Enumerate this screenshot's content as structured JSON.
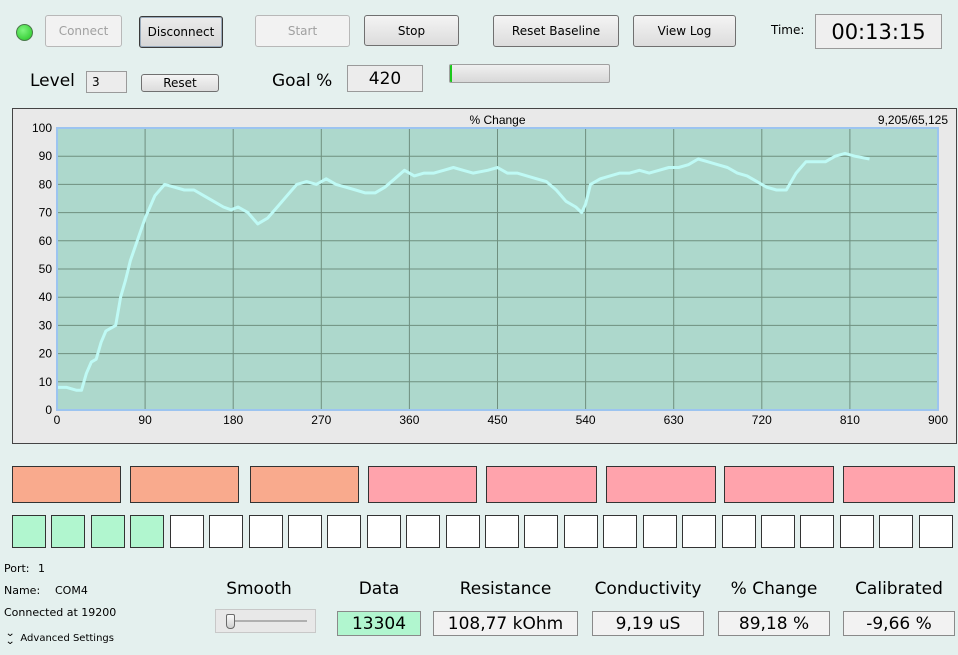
{
  "toolbar": {
    "connect_label": "Connect",
    "disconnect_label": "Disconnect",
    "start_label": "Start",
    "stop_label": "Stop",
    "reset_baseline_label": "Reset Baseline",
    "view_log_label": "View Log",
    "time_label": "Time:",
    "time_value": "00:13:15"
  },
  "controls": {
    "level_label": "Level",
    "level_value": "3",
    "reset_label": "Reset",
    "goal_label": "Goal %",
    "goal_value": "420",
    "goal_progress": 0.01
  },
  "colors": {
    "status_led": "#22c422",
    "plot_background": "#add8cc",
    "series_line": "#bffaf5",
    "stage_orange": "#f9aa8d",
    "stage_pink": "#ffa3ac",
    "step_done": "#b1f6cf"
  },
  "chart_data": {
    "type": "line",
    "title": "% Change",
    "counter": "9,205/65,125",
    "xlim": [
      0,
      900
    ],
    "ylim": [
      0,
      100
    ],
    "x_ticks": [
      0,
      90,
      180,
      270,
      360,
      450,
      540,
      630,
      720,
      810,
      900
    ],
    "y_ticks": [
      0,
      10,
      20,
      30,
      40,
      50,
      60,
      70,
      80,
      90,
      100
    ],
    "grid": true,
    "series": [
      {
        "points": [
          [
            0,
            8
          ],
          [
            10,
            8
          ],
          [
            20,
            7
          ],
          [
            25,
            7
          ],
          [
            30,
            13
          ],
          [
            35,
            17
          ],
          [
            40,
            18
          ],
          [
            45,
            24
          ],
          [
            50,
            28
          ],
          [
            55,
            29
          ],
          [
            60,
            30
          ],
          [
            65,
            40
          ],
          [
            70,
            46
          ],
          [
            75,
            53
          ],
          [
            80,
            58
          ],
          [
            85,
            63
          ],
          [
            90,
            68
          ],
          [
            95,
            72
          ],
          [
            100,
            76
          ],
          [
            105,
            78
          ],
          [
            110,
            80
          ],
          [
            120,
            79
          ],
          [
            130,
            78
          ],
          [
            140,
            78
          ],
          [
            150,
            76
          ],
          [
            160,
            74
          ],
          [
            170,
            72
          ],
          [
            178,
            71
          ],
          [
            185,
            72
          ],
          [
            195,
            70
          ],
          [
            205,
            66
          ],
          [
            215,
            68
          ],
          [
            225,
            72
          ],
          [
            235,
            76
          ],
          [
            245,
            80
          ],
          [
            255,
            81
          ],
          [
            265,
            80
          ],
          [
            275,
            82
          ],
          [
            285,
            80
          ],
          [
            295,
            79
          ],
          [
            305,
            78
          ],
          [
            315,
            77
          ],
          [
            325,
            77
          ],
          [
            335,
            79
          ],
          [
            345,
            82
          ],
          [
            355,
            85
          ],
          [
            365,
            83
          ],
          [
            375,
            84
          ],
          [
            385,
            84
          ],
          [
            395,
            85
          ],
          [
            405,
            86
          ],
          [
            415,
            85
          ],
          [
            425,
            84
          ],
          [
            440,
            85
          ],
          [
            450,
            86
          ],
          [
            460,
            84
          ],
          [
            470,
            84
          ],
          [
            480,
            83
          ],
          [
            490,
            82
          ],
          [
            500,
            81
          ],
          [
            510,
            78
          ],
          [
            520,
            74
          ],
          [
            530,
            72
          ],
          [
            536,
            70
          ],
          [
            540,
            73
          ],
          [
            545,
            80
          ],
          [
            555,
            82
          ],
          [
            565,
            83
          ],
          [
            575,
            84
          ],
          [
            585,
            84
          ],
          [
            595,
            85
          ],
          [
            605,
            84
          ],
          [
            615,
            85
          ],
          [
            625,
            86
          ],
          [
            635,
            86
          ],
          [
            645,
            87
          ],
          [
            655,
            89
          ],
          [
            665,
            88
          ],
          [
            675,
            87
          ],
          [
            685,
            86
          ],
          [
            695,
            84
          ],
          [
            705,
            83
          ],
          [
            715,
            81
          ],
          [
            725,
            79
          ],
          [
            735,
            78
          ],
          [
            745,
            78
          ],
          [
            755,
            84
          ],
          [
            765,
            88
          ],
          [
            775,
            88
          ],
          [
            785,
            88
          ],
          [
            795,
            90
          ],
          [
            805,
            91
          ],
          [
            815,
            90
          ],
          [
            830,
            89
          ]
        ]
      }
    ]
  },
  "stages": {
    "colors": [
      "orange",
      "orange",
      "orange",
      "pink",
      "pink",
      "pink",
      "pink",
      "pink"
    ]
  },
  "steps": {
    "completed": 4,
    "total": 24
  },
  "port_info": {
    "port_label": "Port:",
    "port_value": "1",
    "name_label": "Name:",
    "name_value": "COM4",
    "connected_text": "Connected at 19200",
    "advanced_label": "Advanced Settings"
  },
  "smooth": {
    "label": "Smooth",
    "value": 0.05
  },
  "metrics": {
    "data_label": "Data",
    "data_value": "13304",
    "resistance_label": "Resistance",
    "resistance_value": "108,77 kOhm",
    "conductivity_label": "Conductivity",
    "conductivity_value": "9,19 uS",
    "change_label": "% Change",
    "change_value": "89,18 %",
    "calibrated_label": "Calibrated",
    "calibrated_value": "-9,66 %"
  }
}
